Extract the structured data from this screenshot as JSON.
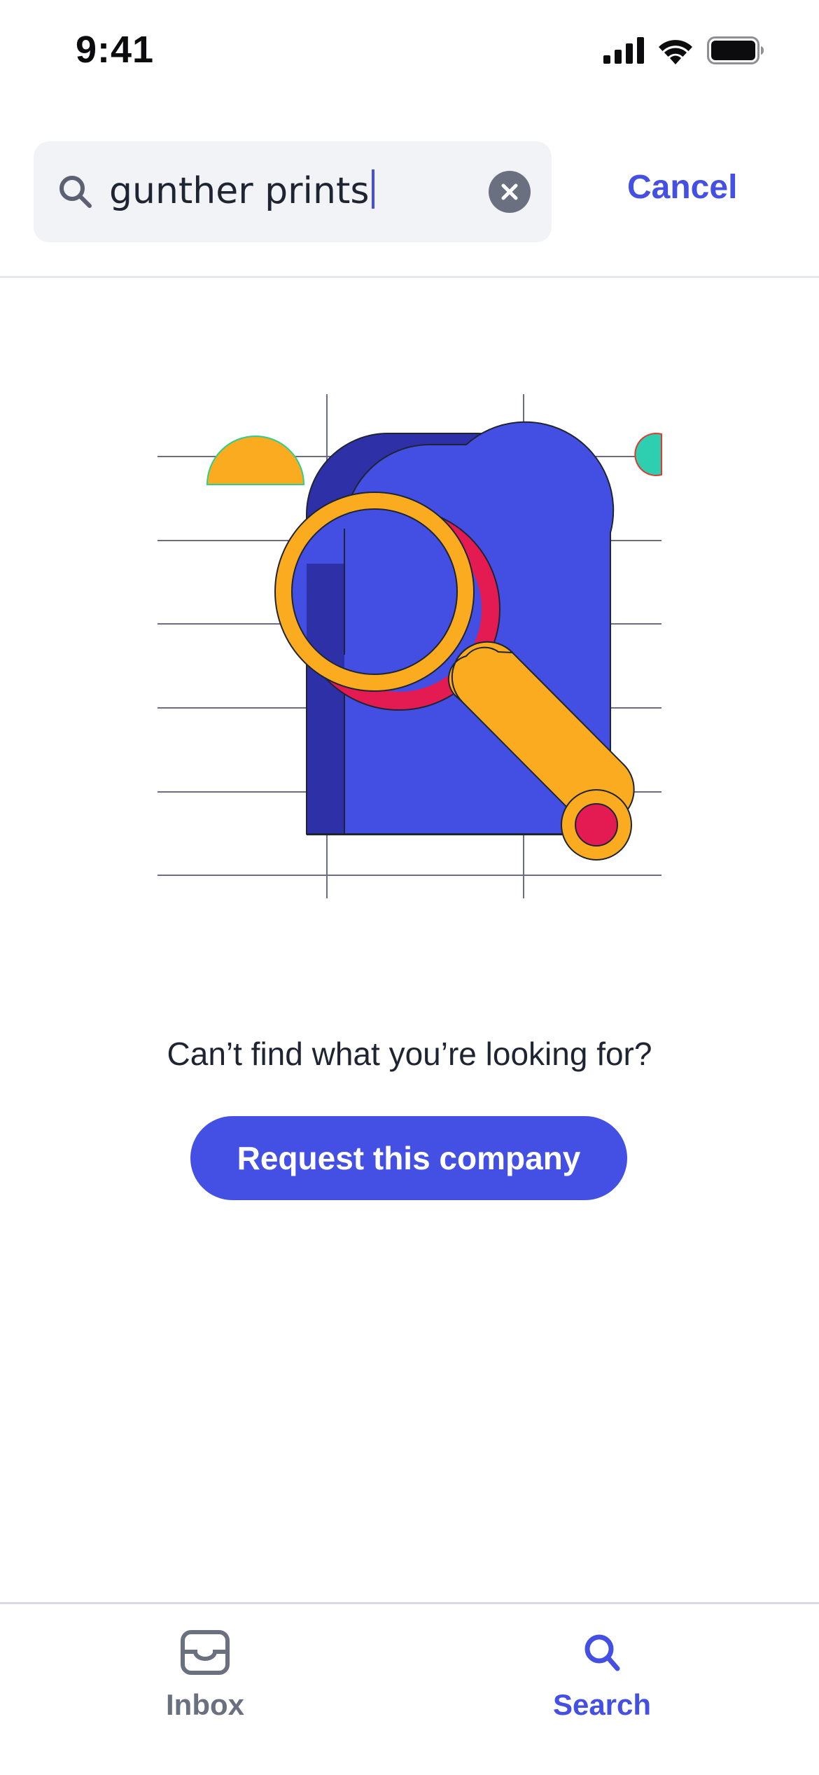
{
  "status_bar": {
    "time": "9:41",
    "icons": [
      "cellular-signal-icon",
      "wifi-icon",
      "battery-icon"
    ]
  },
  "search": {
    "value": "gunther prints",
    "cancel_label": "Cancel",
    "icons": [
      "search-icon",
      "clear-icon"
    ]
  },
  "empty_state": {
    "message": "Can’t find what you’re looking for?",
    "button_label": "Request this company",
    "illustration": "magnifying-glass-over-document-illustration"
  },
  "tab_bar": {
    "tabs": [
      {
        "label": "Inbox",
        "icon": "inbox-tray-icon",
        "active": false
      },
      {
        "label": "Search",
        "icon": "search-icon",
        "active": true
      }
    ]
  },
  "colors": {
    "accent": "#4450e4",
    "muted": "#6b7080",
    "search_field_bg": "#f2f3f7",
    "illustration_yellow": "#fbab1f",
    "illustration_red": "#e41b52",
    "illustration_teal": "#2ecfb0",
    "illustration_dark_blue": "#2e30a8"
  }
}
